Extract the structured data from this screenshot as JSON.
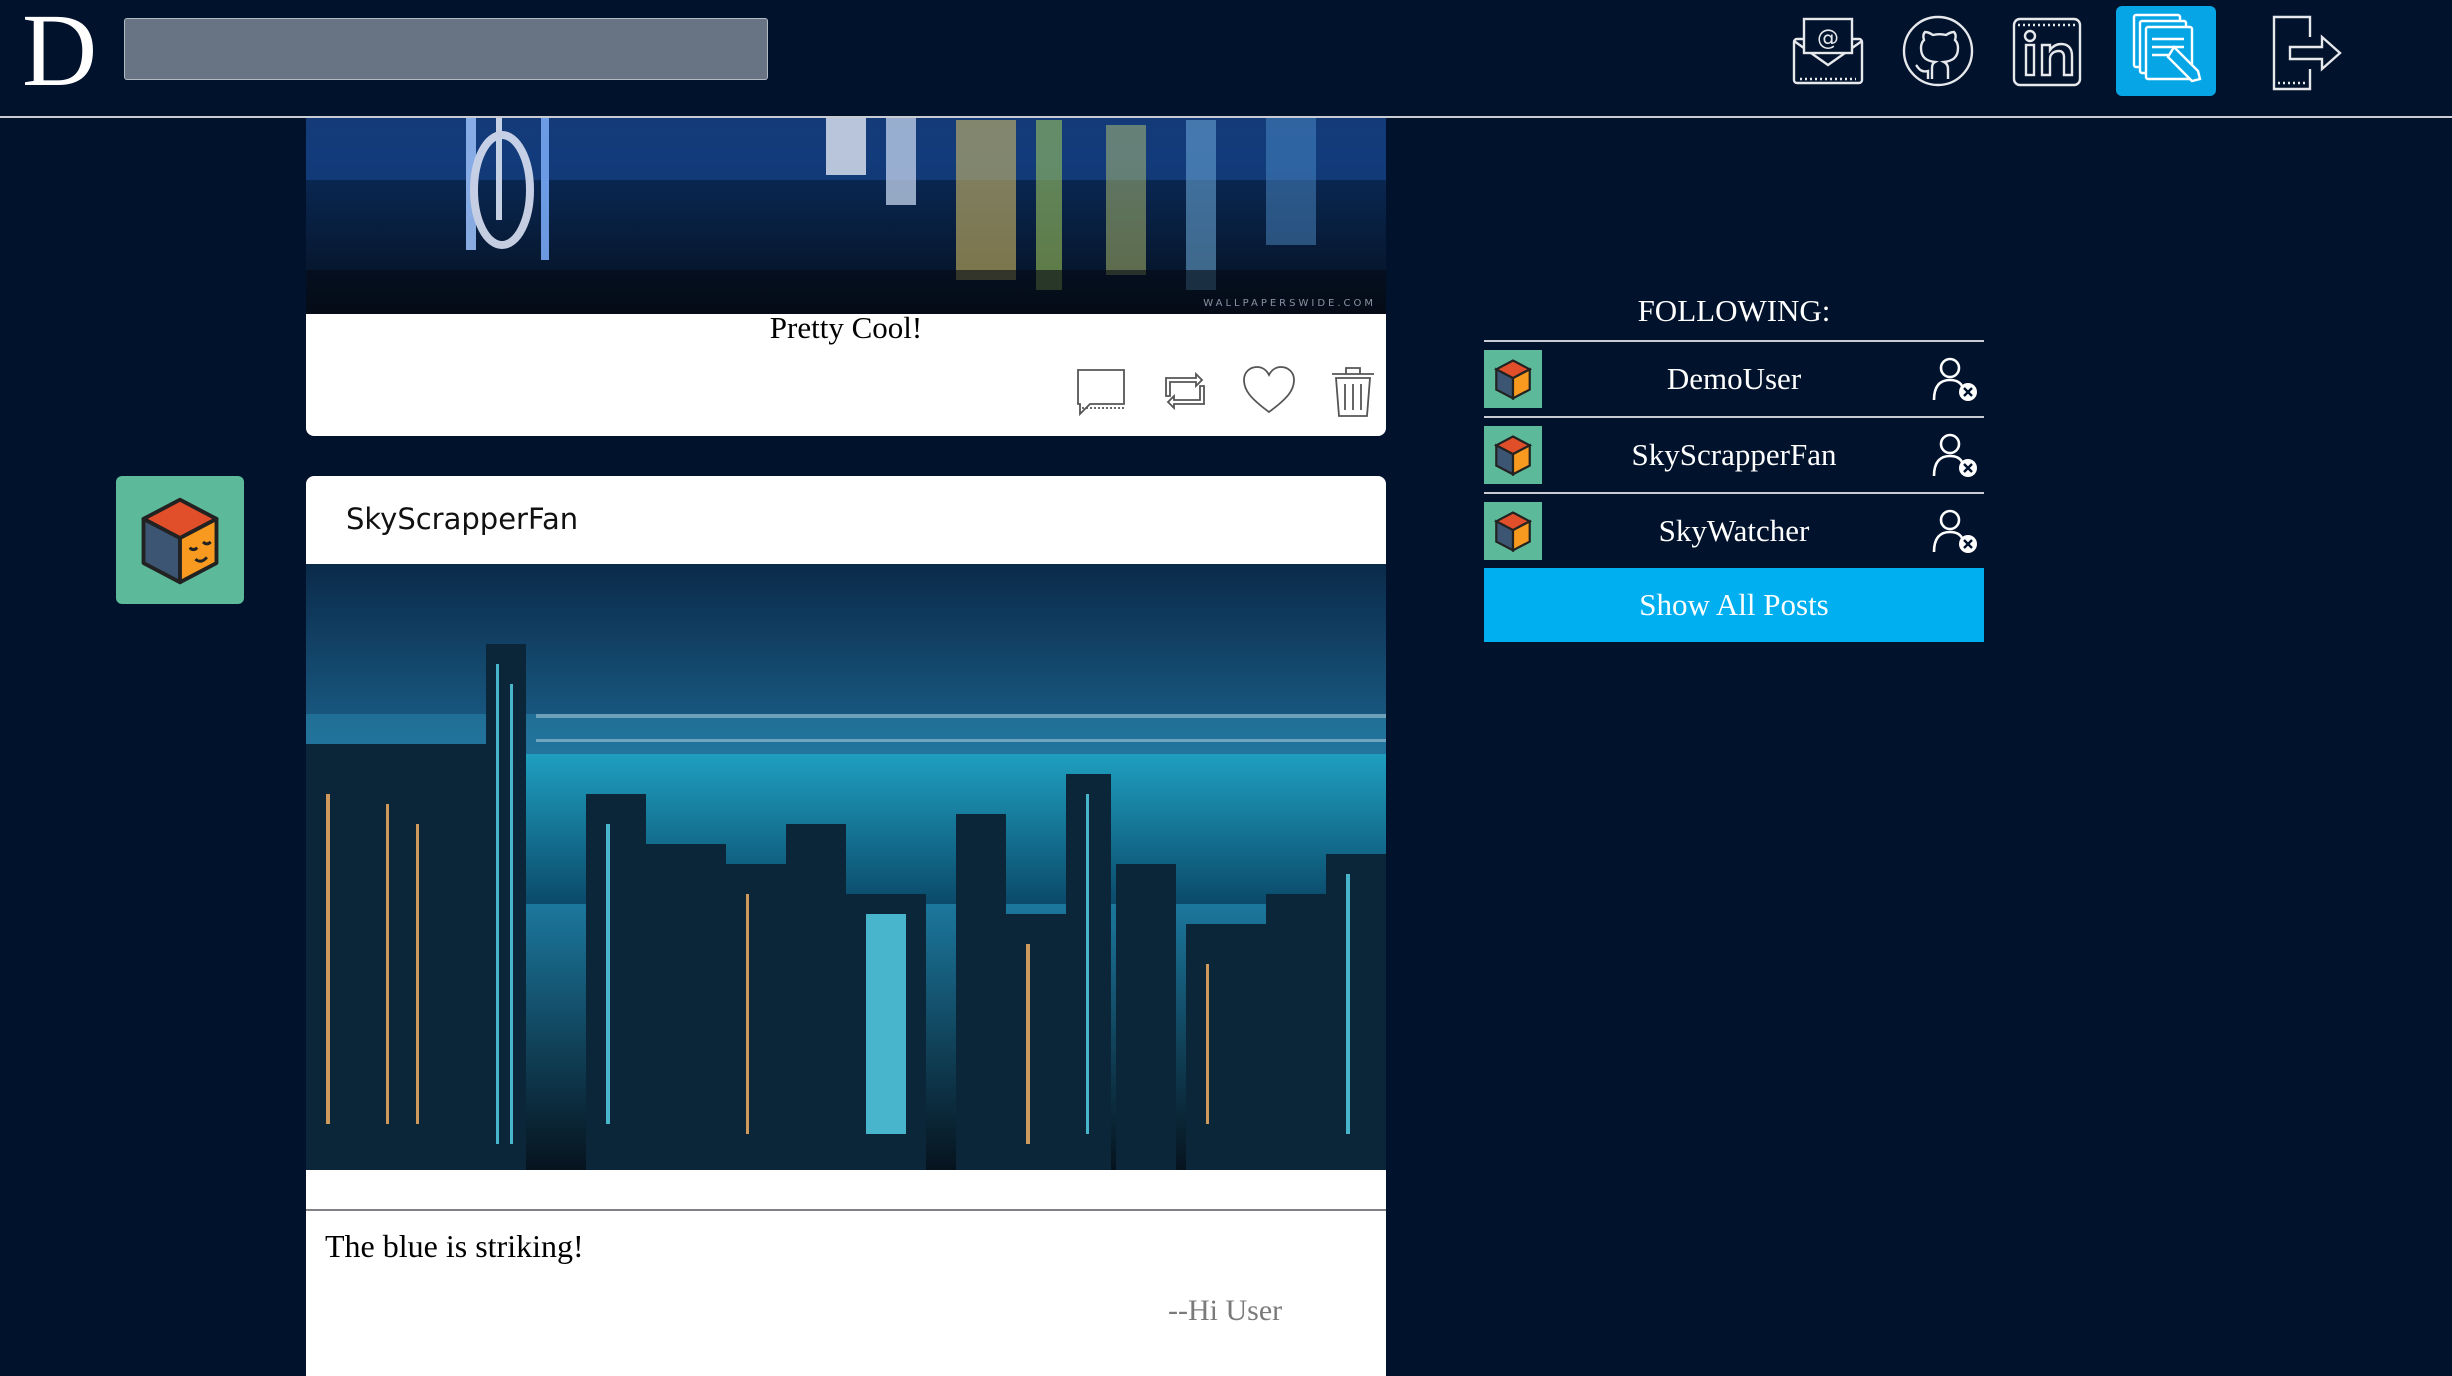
{
  "header": {
    "logo": "D",
    "search_placeholder": "",
    "nav_icons": [
      "email-icon",
      "github-icon",
      "linkedin-icon",
      "posts-icon",
      "logout-icon"
    ],
    "active_icon": "posts-icon"
  },
  "colors": {
    "background": "#01122c",
    "accent": "#00aff0",
    "avatar_bg": "#5cb99a"
  },
  "feed": {
    "post1": {
      "caption": "Pretty Cool!",
      "watermark": "WALLPAPERSWIDE.COM",
      "actions": [
        "comment-icon",
        "repost-icon",
        "heart-icon",
        "trash-icon"
      ]
    },
    "post2": {
      "username": "SkyScrapperFan",
      "caption": "The blue is striking!",
      "signature": "--Hi User"
    }
  },
  "following": {
    "title": "FOLLOWING:",
    "users": [
      {
        "name": "DemoUser"
      },
      {
        "name": "SkyScrapperFan"
      },
      {
        "name": "SkyWatcher"
      }
    ],
    "show_all_label": "Show All Posts"
  }
}
